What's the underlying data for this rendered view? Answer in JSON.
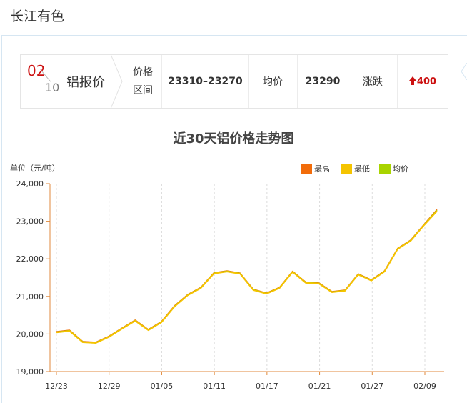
{
  "page_title": "长江有色",
  "quote": {
    "day": "02",
    "month": "10",
    "metal": "铝报价",
    "range_label_line1": "价格",
    "range_label_line2": "区间",
    "range_value": "23310–23270",
    "avg_label": "均价",
    "avg_value": "23290",
    "change_label": "涨跌",
    "change_arrow": "🠉",
    "change_value": "400"
  },
  "colors": {
    "accent_red": "#cc1111",
    "high": "#f26c0a",
    "low": "#f5c400",
    "avg": "#a9d400"
  },
  "chart_data": {
    "type": "line",
    "title": "近30天铝价格走势图",
    "unit_label": "单位（元/吨）",
    "ylim": [
      19000,
      24000
    ],
    "y_ticks": [
      "19,000",
      "20,000",
      "21,000",
      "22,000",
      "23,000",
      "24,000"
    ],
    "x_tick_labels": [
      "12/23",
      "12/29",
      "01/05",
      "01/11",
      "01/17",
      "01/21",
      "01/27",
      "02/09"
    ],
    "x_tick_index": [
      0,
      6,
      12,
      18,
      24,
      30,
      36,
      42
    ],
    "grid": "vertical dashed",
    "legend_position": "top-right",
    "series": [
      {
        "name": "最高",
        "color": "#f26c0a",
        "values": [
          20060,
          20100,
          19800,
          19780,
          19940,
          20160,
          20370,
          20120,
          20330,
          20750,
          21050,
          21240,
          21630,
          21680,
          21620,
          21190,
          21090,
          21240,
          21670,
          21380,
          21360,
          21130,
          21170,
          21600,
          21440,
          21680,
          22280,
          22500,
          22910,
          23310
        ]
      },
      {
        "name": "最低",
        "color": "#f5c400",
        "values": [
          20040,
          20080,
          19780,
          19760,
          19920,
          20140,
          20350,
          20100,
          20310,
          20730,
          21030,
          21220,
          21610,
          21660,
          21600,
          21170,
          21070,
          21220,
          21650,
          21360,
          21340,
          21110,
          21150,
          21580,
          21420,
          21660,
          22260,
          22480,
          22890,
          23270
        ]
      },
      {
        "name": "均价",
        "color": "#a9d400",
        "values": [
          20050,
          20090,
          19790,
          19770,
          19930,
          20150,
          20360,
          20110,
          20320,
          20740,
          21040,
          21230,
          21620,
          21670,
          21610,
          21180,
          21080,
          21230,
          21660,
          21370,
          21350,
          21120,
          21160,
          21590,
          21430,
          21670,
          22270,
          22490,
          22900,
          23290
        ]
      }
    ]
  }
}
